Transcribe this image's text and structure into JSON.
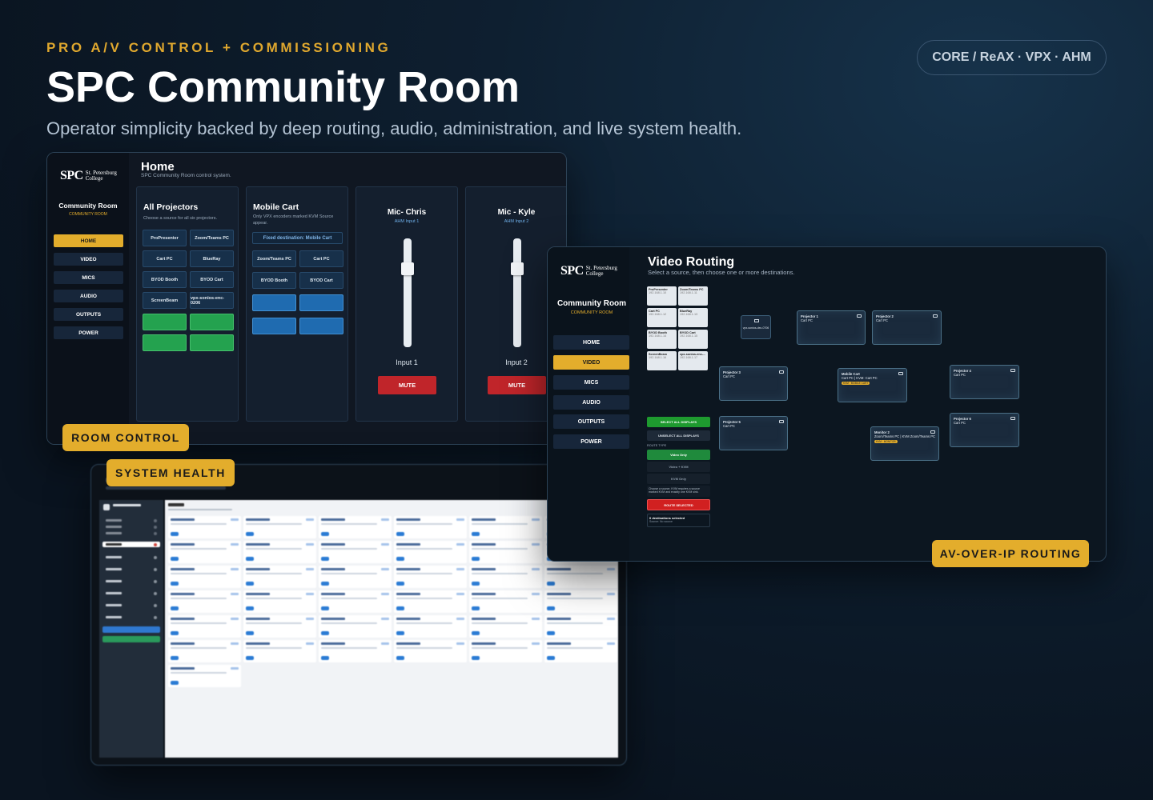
{
  "header": {
    "kicker": "PRO A/V CONTROL + COMMISSIONING",
    "title": "SPC Community Room",
    "subtitle": "Operator simplicity backed by deep routing, audio, administration, and live system health.",
    "tech_badge": "CORE / ReAX · VPX · AHM"
  },
  "labels": {
    "room_control": "ROOM CONTROL",
    "system_health": "SYSTEM HEALTH",
    "av_over_ip": "AV-OVER-IP ROUTING"
  },
  "logo": {
    "mark": "SPC",
    "line1": "St. Petersburg",
    "line2": "College"
  },
  "room_control": {
    "page_title": "Home",
    "page_subtitle": "SPC Community Room control system.",
    "room_name": "Community Room",
    "room_sub": "COMMUNITY ROOM",
    "nav": [
      "HOME",
      "VIDEO",
      "MICS",
      "AUDIO",
      "OUTPUTS",
      "POWER"
    ],
    "all_projectors": {
      "title": "All Projectors",
      "desc": "Choose a source for all six projectors.",
      "sources": [
        "ProPresenter",
        "Zoom/Teams PC",
        "Cart PC",
        "BlueRay",
        "BYOD Booth",
        "BYOD Cart",
        "ScreenBeam",
        "vpx-sonios-enc-0206"
      ]
    },
    "mobile_cart": {
      "title": "Mobile Cart",
      "desc": "Only VPX encoders marked KVM Source appear.",
      "fixed": "Fixed destination: Mobile Cart",
      "sources": [
        "Zoom/Teams PC",
        "Cart PC",
        "BYOD Booth",
        "BYOD Cart"
      ]
    },
    "mics": [
      {
        "title": "Mic- Chris",
        "sub": "AHM Input 1",
        "input": "Input 1",
        "mute": "MUTE"
      },
      {
        "title": "Mic - Kyle",
        "sub": "AHM Input 2",
        "input": "Input 2",
        "mute": "MUTE"
      }
    ]
  },
  "routing": {
    "page_title": "Video Routing",
    "page_subtitle": "Select a source, then choose one or more destinations.",
    "room_name": "Community Room",
    "room_sub": "COMMUNITY ROOM",
    "nav": [
      "HOME",
      "VIDEO",
      "MICS",
      "AUDIO",
      "OUTPUTS",
      "POWER"
    ],
    "sources": [
      {
        "name": "ProPresenter",
        "ip": "192.168.1.10"
      },
      {
        "name": "Zoom/Teams PC",
        "ip": "192.168.1.11"
      },
      {
        "name": "Cart PC",
        "ip": "192.168.1.12"
      },
      {
        "name": "BlueRay",
        "ip": "192.168.1.13"
      },
      {
        "name": "BYOD Booth",
        "ip": "192.168.1.14"
      },
      {
        "name": "BYOD Cart",
        "ip": "192.168.1.15"
      },
      {
        "name": "ScreenBeam",
        "ip": "192.168.1.16"
      },
      {
        "name": "vpx-sonios-enc-...",
        "ip": "192.168.1.17"
      }
    ],
    "buttons": {
      "select_all": "SELECT ALL DISPLAYS",
      "unselect_all": "UNSELECT ALL DISPLAYS",
      "route_type": "ROUTE TYPE",
      "video_only": "Video Only",
      "video_kvm": "Video + KVM",
      "kvm_only": "KVM Only",
      "hint": "Choose a source. KVM requires a source marked KVM and exactly one KVM sink.",
      "route_selected": "ROUTE SELECTED",
      "dest_count": "0 destinations selected",
      "dest_source": "Source: No source"
    },
    "center_node": "vpx-sonios-dec-0706",
    "destinations": [
      {
        "name": "Projector 1",
        "src": "Cart PC"
      },
      {
        "name": "Projector 2",
        "src": "Cart PC"
      },
      {
        "name": "Projector 3",
        "src": "Cart PC"
      },
      {
        "name": "Mobile Cart",
        "src": "Cart PC | KVM: Cart PC",
        "badge": "KVM · MOBILE CART"
      },
      {
        "name": "Projector 4",
        "src": "Cart PC"
      },
      {
        "name": "Projector 5",
        "src": "Cart PC"
      },
      {
        "name": "Monitor 2",
        "src": "Zoom/Teams PC | KVM Zoom/Teams PC",
        "badge": "KVM · MONITOR"
      },
      {
        "name": "Projector 6",
        "src": "Cart PC"
      }
    ]
  },
  "health": {
    "app_title": "System Health",
    "nav_active": "Overall",
    "section": "Overall"
  }
}
